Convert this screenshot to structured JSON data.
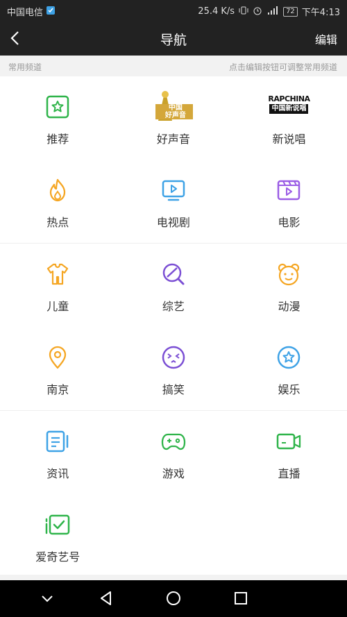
{
  "status": {
    "carrier": "中国电信",
    "speed": "25.4 K/s",
    "battery": "72",
    "time": "下午4:13"
  },
  "header": {
    "title": "导航",
    "edit": "编辑"
  },
  "subbar": {
    "left": "常用频道",
    "right": "点击编辑按钮可调整常用频道"
  },
  "channels": [
    {
      "label": "推荐",
      "icon": "star-square-icon",
      "color": "#2fb44a"
    },
    {
      "label": "好声音",
      "icon": "voice-of-china-logo",
      "color": "#c9a12a"
    },
    {
      "label": "新说唱",
      "icon": "rap-of-china-logo",
      "color": "#111111"
    },
    {
      "label": "热点",
      "icon": "fire-icon",
      "color": "#f5a623"
    },
    {
      "label": "电视剧",
      "icon": "tv-icon",
      "color": "#3ea2e6"
    },
    {
      "label": "电影",
      "icon": "film-icon",
      "color": "#9b5de5"
    },
    {
      "label": "儿童",
      "icon": "kids-clothes-icon",
      "color": "#f5a623"
    },
    {
      "label": "综艺",
      "icon": "variety-icon",
      "color": "#7b4fd4"
    },
    {
      "label": "动漫",
      "icon": "bear-face-icon",
      "color": "#f5a623"
    },
    {
      "label": "南京",
      "icon": "location-pin-icon",
      "color": "#f5a623"
    },
    {
      "label": "搞笑",
      "icon": "funny-face-icon",
      "color": "#7b4fd4"
    },
    {
      "label": "娱乐",
      "icon": "star-circle-icon",
      "color": "#3ea2e6"
    },
    {
      "label": "资讯",
      "icon": "news-icon",
      "color": "#3ea2e6"
    },
    {
      "label": "游戏",
      "icon": "gamepad-icon",
      "color": "#2fb44a"
    },
    {
      "label": "直播",
      "icon": "live-camera-icon",
      "color": "#2fb44a"
    },
    {
      "label": "爱奇艺号",
      "icon": "iqiyi-account-icon",
      "color": "#2fb44a"
    }
  ],
  "logos": {
    "voice_line1": "中国",
    "voice_line2": "好声音",
    "rap_line1": "RAPCHINA",
    "rap_line2": "中国新说唱"
  }
}
